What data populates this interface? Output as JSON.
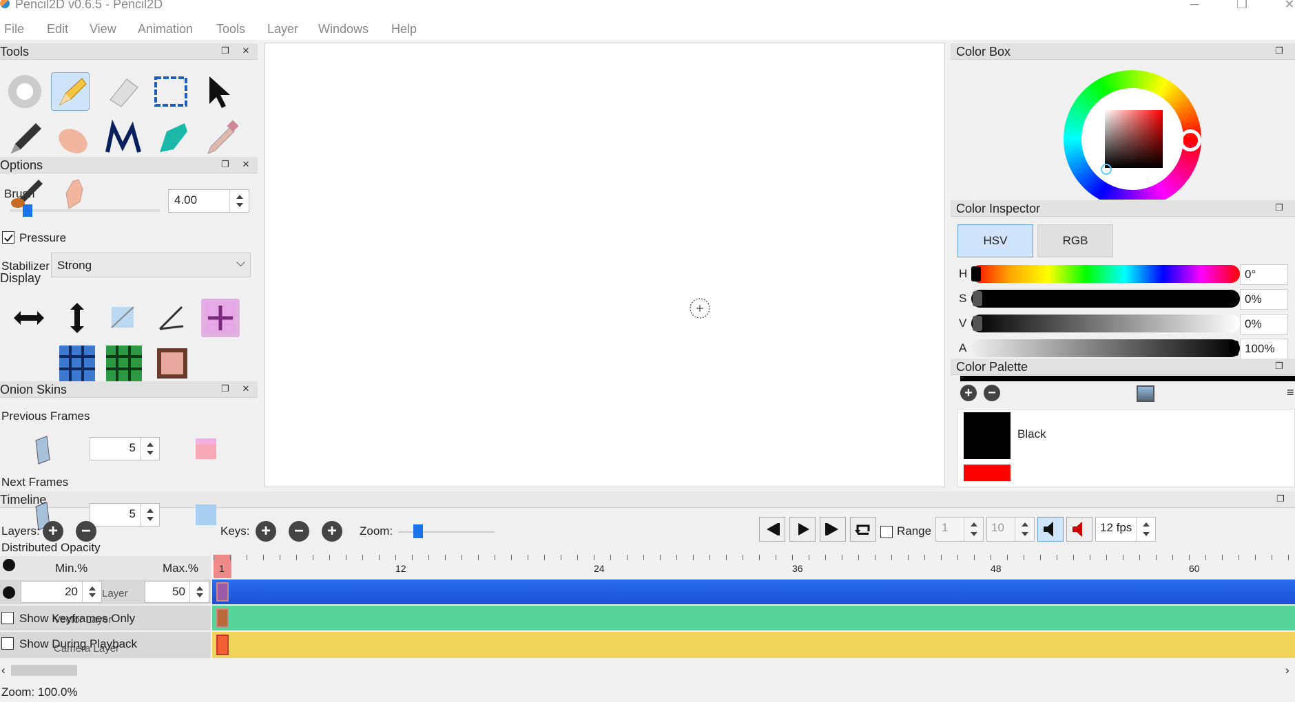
{
  "window": {
    "title": "Pencil2D v0.6.5 - Pencil2D"
  },
  "menu": [
    "File",
    "Edit",
    "View",
    "Animation",
    "Tools",
    "Layer",
    "Windows",
    "Help"
  ],
  "tools_panel": {
    "title": "Tools"
  },
  "options_panel": {
    "title": "Options",
    "brush_label": "Brush",
    "size_value": "4.00",
    "pressure_label": "Pressure",
    "stabilizer_label": "Stabilizer",
    "stabilizer_value": "Strong"
  },
  "display_panel": {
    "title": "Display"
  },
  "onion_panel": {
    "title": "Onion Skins",
    "prev_label": "Previous Frames",
    "prev_value": "5",
    "next_label": "Next Frames",
    "next_value": "5",
    "distributed_label": "Distributed Opacity",
    "min_label": "Min.%",
    "max_label": "Max.%",
    "min_value": "20",
    "max_value": "50",
    "show_keyframes": "Show Keyframes Only",
    "show_playback": "Show During Playback"
  },
  "color_box": {
    "title": "Color Box"
  },
  "color_inspector": {
    "title": "Color Inspector",
    "tab_hsv": "HSV",
    "tab_rgb": "RGB",
    "rows": [
      {
        "label": "H",
        "value": "0°"
      },
      {
        "label": "S",
        "value": "0%"
      },
      {
        "label": "V",
        "value": "0%"
      },
      {
        "label": "A",
        "value": "100%"
      }
    ]
  },
  "color_palette": {
    "title": "Color Palette",
    "items": [
      {
        "name": "Black",
        "color": "#000000"
      },
      {
        "name": "",
        "color": "#ff0000"
      }
    ]
  },
  "timeline": {
    "title": "Timeline",
    "layers_label": "Layers:",
    "keys_label": "Keys:",
    "zoom_label": "Zoom:",
    "range_label": "Range",
    "range_start": "1",
    "range_end": "10",
    "fps": "12 fps",
    "ruler": [
      "1",
      "12",
      "24",
      "36",
      "48",
      "60"
    ],
    "layers": [
      {
        "name": "Layer",
        "color": "#2a6ef0"
      },
      {
        "name": "Vector Layer",
        "color": "#55d59a"
      },
      {
        "name": "Camera Layer",
        "color": "#f1d35a"
      }
    ]
  },
  "status": {
    "zoom": "Zoom: 100.0%"
  },
  "colors": {
    "accent": "#2a6ef0",
    "selected": "#cfe4fb"
  }
}
